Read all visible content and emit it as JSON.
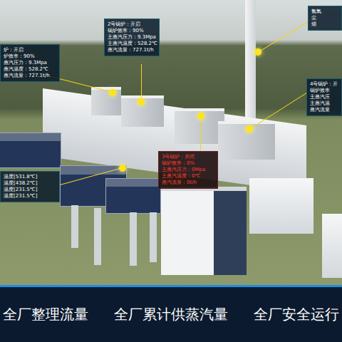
{
  "callouts": [
    {
      "lines": [
        "炉：开启",
        "炉效率：90%",
        "蒸汽压力：9.3Mpa",
        "蒸汽温度：528.2℃",
        "蒸汽流量：727.1t/h"
      ],
      "on": true
    },
    {
      "lines": [
        "2号锅炉：开启",
        "锅炉效率：90%",
        "主蒸汽压力：9.3Mpa",
        "主蒸汽温度：528.2℃",
        "蒸汽流量：727.1t/h"
      ],
      "on": true
    },
    {
      "lines": [
        "氮氧",
        "尘",
        "烟"
      ],
      "on": true
    },
    {
      "lines": [
        "4号锅炉：开",
        "锅炉效率",
        "主蒸汽压",
        "主蒸汽温",
        "蒸汽流量"
      ],
      "on": true
    },
    {
      "lines": [
        "3号锅炉：关闭",
        "锅炉效率：0%",
        "主蒸汽压力：0Mpa",
        "主蒸汽温度：0℃",
        "蒸汽流量：0t/h"
      ],
      "on": false
    },
    {
      "lines": [
        "温度[531.8℃]",
        "温度[438.2℃]",
        "温度[231.5℃]",
        "温度[231.5℃]"
      ],
      "on": true
    }
  ],
  "bottom_bar": {
    "items": [
      "全厂整理流量",
      "全厂累计供蒸汽量",
      "全厂安全运行"
    ]
  }
}
